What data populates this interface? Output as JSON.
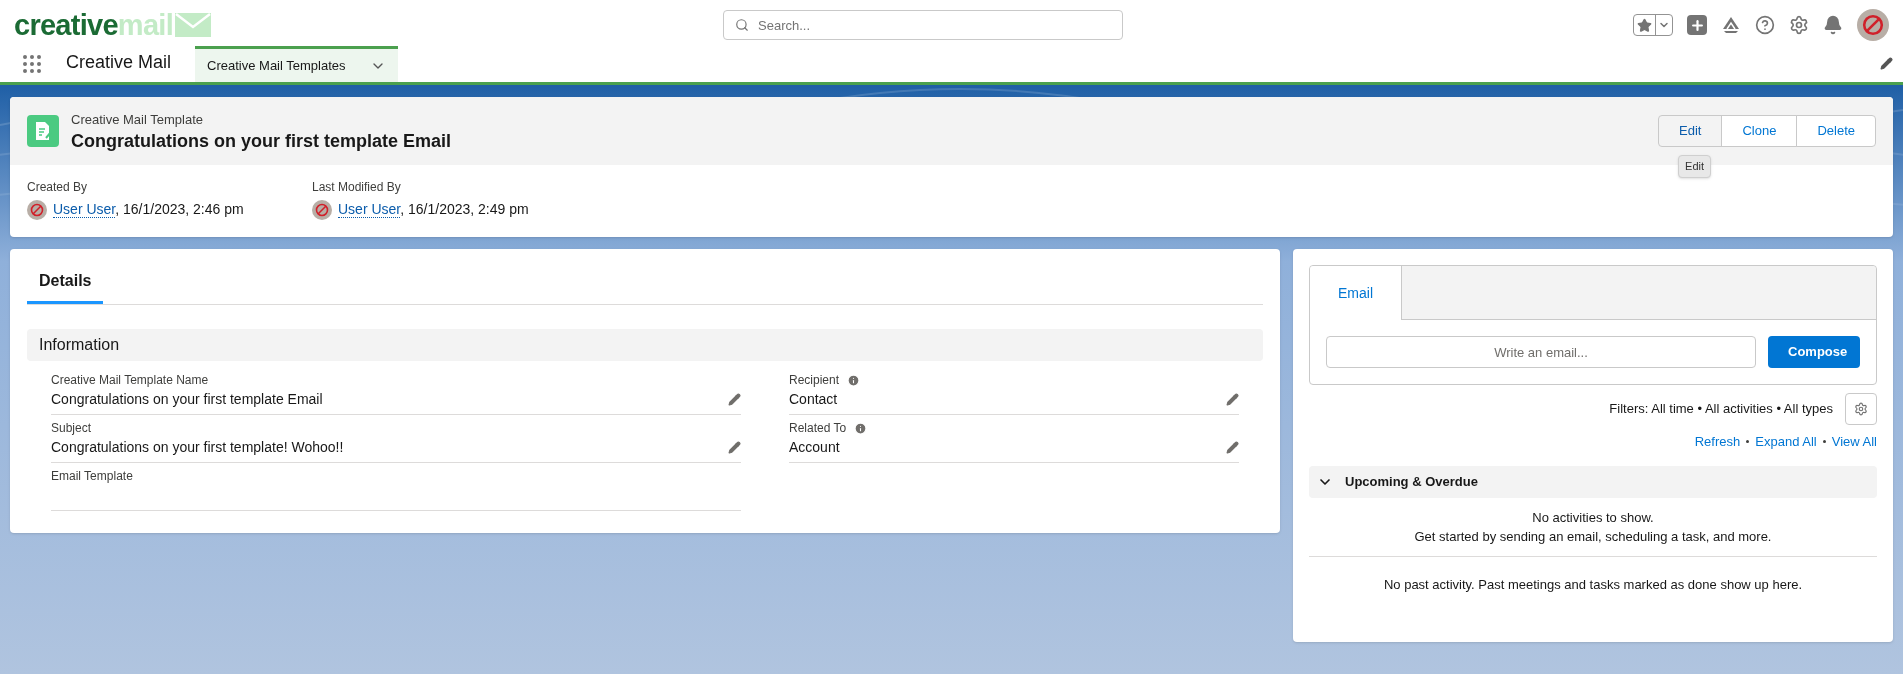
{
  "header": {
    "logo": {
      "part_1": "creative",
      "part_2": "mail"
    },
    "search": {
      "placeholder": "Search..."
    }
  },
  "nav": {
    "app_name": "Creative Mail",
    "tabs": [
      {
        "label": "Creative Mail Templates",
        "selected": true
      }
    ]
  },
  "record": {
    "object_type": "Creative Mail Template",
    "title": "Congratulations on your first template Email",
    "actions": [
      {
        "label": "Edit",
        "hovered": true
      },
      {
        "label": "Clone",
        "hovered": false
      },
      {
        "label": "Delete",
        "hovered": false
      }
    ],
    "tooltip": "Edit",
    "meta": [
      {
        "label": "Created By",
        "user": "User User",
        "time": ", 16/1/2023, 2:46 pm"
      },
      {
        "label": "Last Modified By",
        "user": "User User",
        "time": ", 16/1/2023, 2:49 pm"
      }
    ]
  },
  "details": {
    "tabs": [
      {
        "label": "Details",
        "selected": true
      }
    ],
    "section": "Information",
    "fields": [
      {
        "label": "Creative Mail Template Name",
        "value": "Congratulations on your first template Email",
        "info": false,
        "editable": true
      },
      {
        "label": "Recipient",
        "value": "Contact",
        "info": true,
        "editable": true
      },
      {
        "label": "Subject",
        "value": "Congratulations on your first template! Wohoo!!",
        "info": false,
        "editable": true
      },
      {
        "label": "Related To",
        "value": "Account",
        "info": true,
        "editable": true
      },
      {
        "label": "Email Template",
        "info": false,
        "editable": false
      }
    ]
  },
  "activity": {
    "tabs": [
      {
        "label": "Email",
        "selected": true
      }
    ],
    "composer": {
      "placeholder": "Write an email...",
      "button": "Compose"
    },
    "filters": "Filters: All time • All activities • All types",
    "links": [
      "Refresh",
      "Expand All",
      "View All"
    ],
    "upcoming": {
      "title": "Upcoming & Overdue",
      "expanded": true,
      "empty_lines": [
        "No activities to show.",
        "Get started by sending an email, scheduling a task, and more."
      ]
    },
    "past": "No past activity. Past meetings and tasks marked as done show up here."
  }
}
